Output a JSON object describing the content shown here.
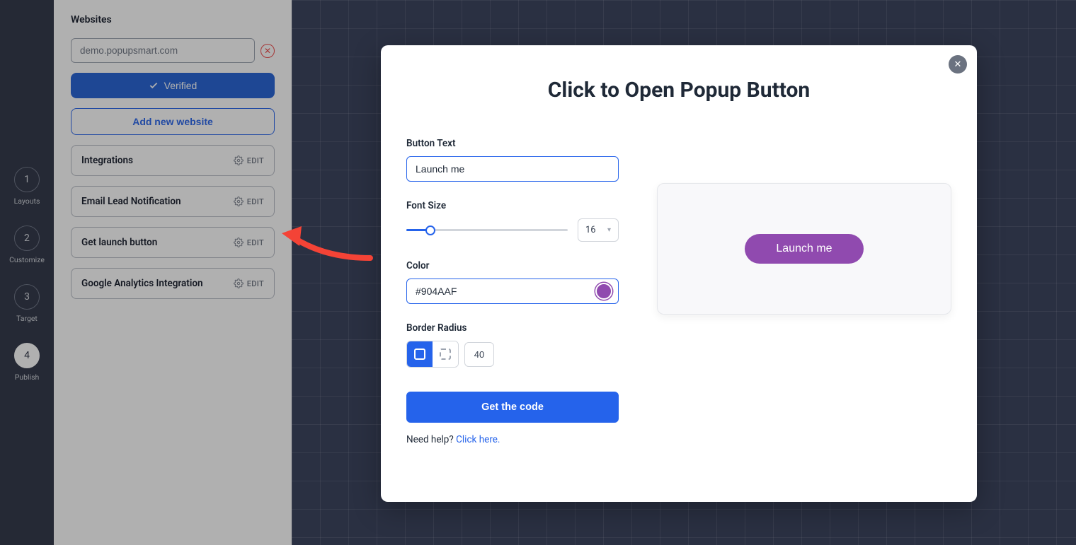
{
  "stepper": {
    "items": [
      {
        "num": "1",
        "label": "Layouts"
      },
      {
        "num": "2",
        "label": "Customize"
      },
      {
        "num": "3",
        "label": "Target"
      },
      {
        "num": "4",
        "label": "Publish"
      }
    ]
  },
  "sidebar": {
    "header": "Websites",
    "website": "demo.popupsmart.com",
    "verified_label": "Verified",
    "add_website_label": "Add new website",
    "panels": [
      {
        "title": "Integrations",
        "action": "EDIT"
      },
      {
        "title": "Email Lead Notification",
        "action": "EDIT"
      },
      {
        "title": "Get launch button",
        "action": "EDIT"
      },
      {
        "title": "Google Analytics Integration",
        "action": "EDIT"
      }
    ]
  },
  "modal": {
    "title": "Click to Open Popup Button",
    "button_text_label": "Button Text",
    "button_text_value": "Launch me",
    "font_size_label": "Font Size",
    "font_size_value": "16",
    "color_label": "Color",
    "color_value": "#904AAF",
    "border_radius_label": "Border Radius",
    "border_radius_value": "40",
    "get_code_label": "Get the code",
    "help_text": "Need help? ",
    "help_link": "Click here.",
    "preview_button_label": "Launch me"
  }
}
